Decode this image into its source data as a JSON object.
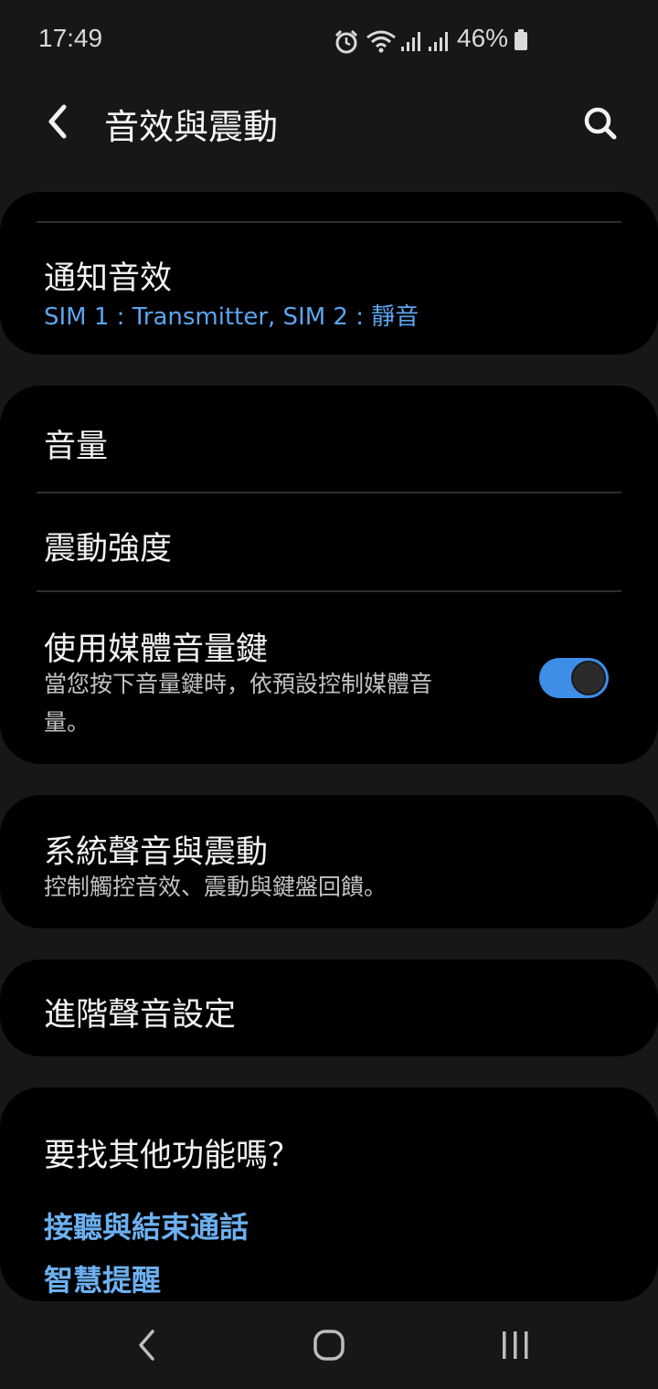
{
  "status_bar": {
    "time": "17:49",
    "battery_percent": "46%",
    "icons": [
      "alarm-icon",
      "wifi-icon",
      "signal-sim1-icon",
      "signal-sim2-icon",
      "battery-icon"
    ]
  },
  "header": {
    "title": "音效與震動",
    "back_icon": "back-chevron-icon",
    "search_icon": "search-icon"
  },
  "cards": {
    "notification": {
      "title": "通知音效",
      "subtitle": "SIM 1 : Transmitter, SIM 2 : 靜音"
    },
    "volume_group": {
      "volume_title": "音量",
      "vibration_title": "震動強度",
      "media_keys_title": "使用媒體音量鍵",
      "media_keys_subtitle_line1": "當您按下音量鍵時，依預設控制媒體音",
      "media_keys_subtitle_line2": "量。",
      "media_keys_enabled": true
    },
    "system": {
      "title": "系統聲音與震動",
      "subtitle": "控制觸控音效、震動與鍵盤回饋。"
    },
    "advanced": {
      "title": "進階聲音設定"
    },
    "more": {
      "title": "要找其他功能嗎？",
      "links": [
        "接聽與結束通話",
        "智慧提醒"
      ]
    }
  },
  "nav_bar": {
    "icons": [
      "nav-back-icon",
      "nav-home-icon",
      "nav-recents-icon"
    ]
  },
  "colors": {
    "background": "#171717",
    "card": "#000000",
    "accent_blue": "#5aa6ef",
    "toggle_on": "#3e8ee8"
  }
}
